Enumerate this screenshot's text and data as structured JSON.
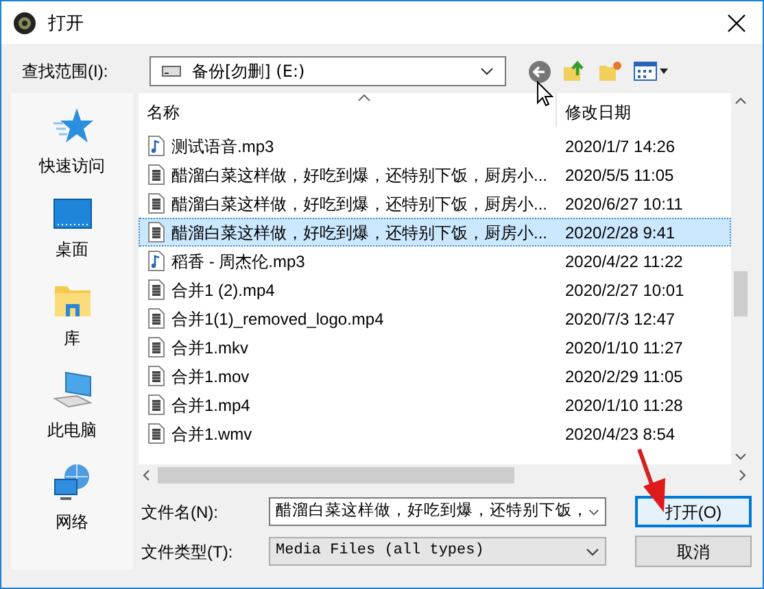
{
  "window": {
    "title": "打开"
  },
  "look_in": {
    "label": "查找范围(I):",
    "value": "备份[勿删] (E:)"
  },
  "sidebar": {
    "items": [
      {
        "label": "快速访问",
        "kind": "star"
      },
      {
        "label": "桌面",
        "kind": "desktop"
      },
      {
        "label": "库",
        "kind": "library"
      },
      {
        "label": "此电脑",
        "kind": "computer"
      },
      {
        "label": "网络",
        "kind": "network"
      }
    ]
  },
  "table": {
    "columns": [
      "名称",
      "修改日期"
    ],
    "rows": [
      {
        "name": "测试语音.mp3",
        "date": "2020/1/7 14:26",
        "kind": "audio",
        "selected": false
      },
      {
        "name": "醋溜白菜这样做，好吃到爆，还特别下饭，厨房小...",
        "date": "2020/5/5 11:05",
        "kind": "video",
        "selected": false
      },
      {
        "name": "醋溜白菜这样做，好吃到爆，还特别下饭，厨房小...",
        "date": "2020/6/27 10:11",
        "kind": "video",
        "selected": false
      },
      {
        "name": "醋溜白菜这样做，好吃到爆，还特别下饭，厨房小...",
        "date": "2020/2/28 9:41",
        "kind": "video",
        "selected": true
      },
      {
        "name": "稻香 - 周杰伦.mp3",
        "date": "2020/4/22 11:22",
        "kind": "audio",
        "selected": false
      },
      {
        "name": "合并1 (2).mp4",
        "date": "2020/2/27 10:01",
        "kind": "video",
        "selected": false
      },
      {
        "name": "合并1(1)_removed_logo.mp4",
        "date": "2020/7/3 12:47",
        "kind": "video",
        "selected": false
      },
      {
        "name": "合并1.mkv",
        "date": "2020/1/10 11:27",
        "kind": "video",
        "selected": false
      },
      {
        "name": "合并1.mov",
        "date": "2020/2/29 11:05",
        "kind": "video",
        "selected": false
      },
      {
        "name": "合并1.mp4",
        "date": "2020/1/10 11:28",
        "kind": "video",
        "selected": false
      },
      {
        "name": "合并1.wmv",
        "date": "2020/4/23 8:54",
        "kind": "video",
        "selected": false
      }
    ]
  },
  "file_name": {
    "label": "文件名(N):",
    "value": "醋溜白菜这样做，好吃到爆，还特别下饭，"
  },
  "file_type": {
    "label": "文件类型(T):",
    "value": "Media Files (all types)"
  },
  "buttons": [
    {
      "label": "打开(O)",
      "kind": "default"
    },
    {
      "label": "取消",
      "kind": "normal"
    }
  ]
}
